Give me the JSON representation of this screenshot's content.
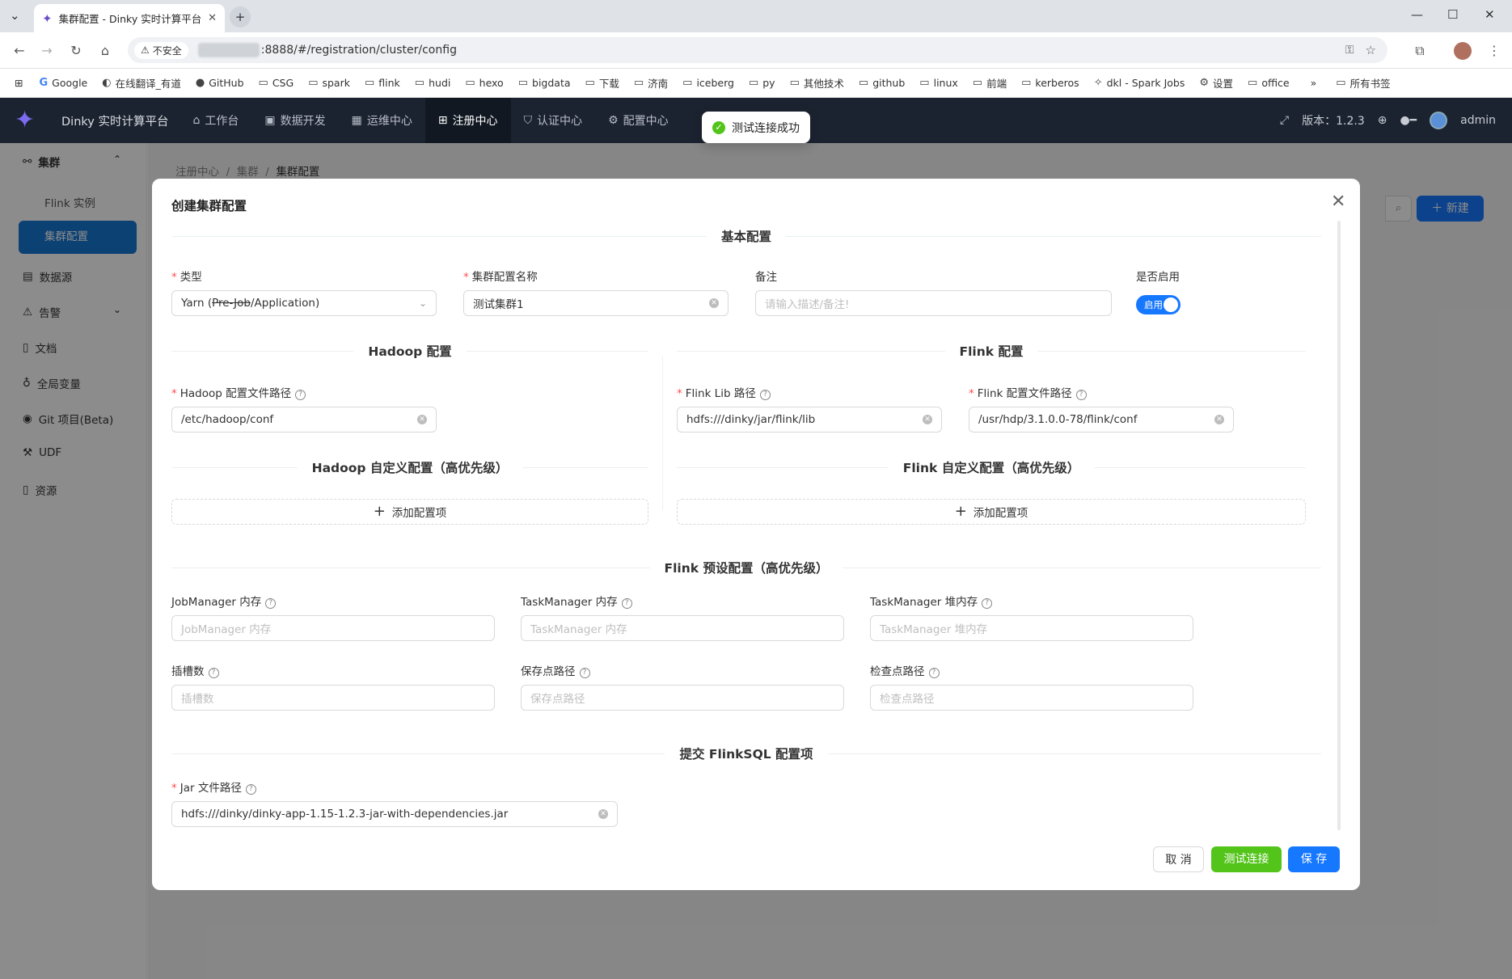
{
  "browser": {
    "tab_title": "集群配置 - Dinky 实时计算平台",
    "security_label": "不安全",
    "url": ":8888/#/registration/cluster/config",
    "bookmarks": [
      "Google",
      "在线翻译_有道",
      "GitHub",
      "CSG",
      "spark",
      "flink",
      "hudi",
      "hexo",
      "bigdata",
      "下载",
      "济南",
      "iceberg",
      "py",
      "其他技术",
      "github",
      "linux",
      "前端",
      "kerberos",
      "dkl - Spark Jobs",
      "设置",
      "office"
    ],
    "all_bookmarks": "所有书签"
  },
  "app": {
    "title": "Dinky 实时计算平台",
    "menus": [
      "工作台",
      "数据开发",
      "运维中心",
      "注册中心",
      "认证中心",
      "配置中心"
    ],
    "version": "版本：1.2.3",
    "user": "admin"
  },
  "toast": "测试连接成功",
  "sidebar": {
    "group": "集群",
    "subitems": [
      "Flink 实例",
      "集群配置"
    ],
    "items": [
      "数据源",
      "告警",
      "文档",
      "全局变量",
      "Git 项目(Beta)",
      "UDF",
      "资源"
    ]
  },
  "breadcrumb": [
    "注册中心",
    "集群",
    "集群配置"
  ],
  "new_button": "新建",
  "modal": {
    "title": "创建集群配置",
    "sections": {
      "basic": "基本配置",
      "hadoop": "Hadoop 配置",
      "flink": "Flink 配置",
      "hadoop_custom": "Hadoop 自定义配置（高优先级）",
      "flink_custom": "Flink 自定义配置（高优先级）",
      "flink_preset": "Flink 预设配置（高优先级）",
      "flinksql": "提交 FlinkSQL 配置项"
    },
    "fields": {
      "type_label": "类型",
      "type_value_a": "Yarn (",
      "type_value_strike": "Pre-Job",
      "type_value_b": "/Application)",
      "name_label": "集群配置名称",
      "name_value": "测试集群1",
      "note_label": "备注",
      "note_placeholder": "请输入描述/备注!",
      "enabled_label": "是否启用",
      "enabled_text": "启用",
      "hadoop_path_label": "Hadoop 配置文件路径",
      "hadoop_path_value": "/etc/hadoop/conf",
      "flink_lib_label": "Flink Lib 路径",
      "flink_lib_value": "hdfs:///dinky/jar/flink/lib",
      "flink_conf_label": "Flink 配置文件路径",
      "flink_conf_value": "/usr/hdp/3.1.0.0-78/flink/conf",
      "add_config": "添加配置项",
      "jm_label": "JobManager 内存",
      "jm_placeholder": "JobManager 内存",
      "tm_label": "TaskManager 内存",
      "tm_placeholder": "TaskManager 内存",
      "tmheap_label": "TaskManager 堆内存",
      "tmheap_placeholder": "TaskManager 堆内存",
      "slots_label": "插槽数",
      "slots_placeholder": "插槽数",
      "savepoint_label": "保存点路径",
      "savepoint_placeholder": "保存点路径",
      "checkpoint_label": "检查点路径",
      "checkpoint_placeholder": "检查点路径",
      "jar_label": "Jar 文件路径",
      "jar_value": "hdfs:///dinky/dinky-app-1.15-1.2.3-jar-with-dependencies.jar"
    },
    "buttons": {
      "cancel": "取 消",
      "test": "测试连接",
      "save": "保 存"
    }
  },
  "colors": {
    "primary": "#1677ff",
    "success": "#52c41a",
    "header_bg": "#1c2330"
  }
}
